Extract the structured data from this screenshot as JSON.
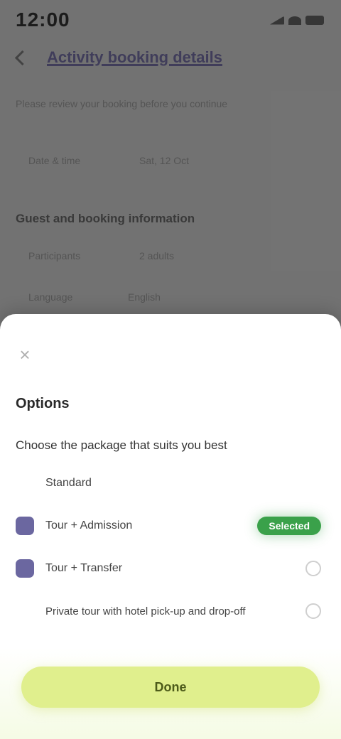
{
  "status_bar": {
    "time": "12:00",
    "icons": [
      "signal-icon",
      "wifi-icon",
      "battery-icon"
    ]
  },
  "background_page": {
    "back_icon": "chevron-left-icon",
    "title": "Activity booking details",
    "description": "Please review your booking before you continue",
    "row1": {
      "left": "Date & time",
      "right": "Sat, 12 Oct"
    },
    "section_heading": "Guest and booking information",
    "row2": {
      "left": "Participants",
      "right": "2 adults"
    },
    "row3": {
      "left": "Language",
      "right": "English"
    }
  },
  "sheet": {
    "close_icon": "close-icon",
    "title": "Options",
    "subtitle": "Choose the package that suits you best",
    "items": [
      {
        "label": "Standard",
        "icon": "none",
        "state": "none"
      },
      {
        "label": "Tour + Admission",
        "icon": "ticket-icon",
        "state": "badge",
        "badge": "Selected"
      },
      {
        "label": "Tour + Transfer",
        "icon": "bus-icon",
        "state": "unchecked"
      },
      {
        "label": "Private tour with hotel pick-up and drop-off",
        "icon": "none",
        "state": "unchecked"
      }
    ],
    "primary_button": "Done"
  },
  "colors": {
    "scrim": "#7a7a7a",
    "accent_button": "#e0ef8d",
    "badge_green": "#3aa14a",
    "item_icon": "#3a3480"
  }
}
